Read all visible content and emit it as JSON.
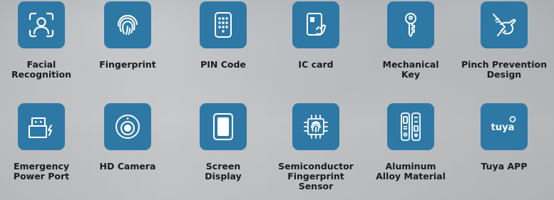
{
  "features": [
    {
      "label": "Facial\nRecognition",
      "icon": "face-scan-icon"
    },
    {
      "label": "Fingerprint",
      "icon": "fingerprint-icon"
    },
    {
      "label": "PIN Code",
      "icon": "keypad-icon"
    },
    {
      "label": "IC card",
      "icon": "ic-card-icon"
    },
    {
      "label": "Mechanical\nKey",
      "icon": "key-icon"
    },
    {
      "label": "Pinch Prevention\nDesign",
      "icon": "pinch-hand-icon"
    },
    {
      "label": "Emergency\nPower Port",
      "icon": "usb-power-icon"
    },
    {
      "label": "HD Camera",
      "icon": "camera-icon"
    },
    {
      "label": "Screen\nDisplay",
      "icon": "screen-icon"
    },
    {
      "label": "Semiconductor\nFingerprint\nSensor",
      "icon": "chip-icon"
    },
    {
      "label": "Aluminum\nAlloy Material",
      "icon": "lock-body-icon"
    },
    {
      "label": "Tuya APP",
      "icon": "tuya-logo-icon"
    }
  ],
  "tuya_logo_text": "tuya",
  "colors": {
    "tile": "#2e78a6",
    "label": "#1b1b1b"
  }
}
